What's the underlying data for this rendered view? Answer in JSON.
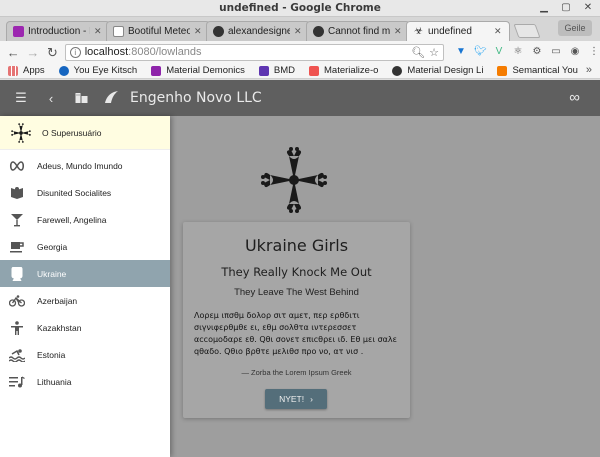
{
  "window": {
    "title": "undefined - Google Chrome"
  },
  "tabs": [
    {
      "label": "Introduction - Mat",
      "fav_color": "#9c27b0"
    },
    {
      "label": "Bootiful Meteor De",
      "fav_color": "#cccccc"
    },
    {
      "label": "alexandesigner/qu",
      "fav_color": "#333333"
    },
    {
      "label": "Cannot find modu",
      "fav_color": "#333333"
    },
    {
      "label": "undefined",
      "fav_color": "#555555",
      "active": true
    }
  ],
  "profile_label": "Geile",
  "address": {
    "host": "localhost",
    "rest": ":8080/lowlands"
  },
  "bookmarks": [
    {
      "label": "Apps",
      "color": "#e57373"
    },
    {
      "label": "You Eye Kitsch",
      "color": "#1565c0"
    },
    {
      "label": "Material Demonics",
      "color": "#8e24aa"
    },
    {
      "label": "BMD",
      "color": "#5e35b1"
    },
    {
      "label": "Materialize-o",
      "color": "#ef5350"
    },
    {
      "label": "Material Design Li",
      "color": "#333333"
    },
    {
      "label": "Semantical You",
      "color": "#f57c00"
    }
  ],
  "appbar": {
    "title": "Engenho Novo LLC"
  },
  "user": {
    "name": "O Superusuário"
  },
  "nav": [
    {
      "label": "Adeus, Mundo Imundo",
      "icon": "infinity-icon"
    },
    {
      "label": "Disunited Socialites",
      "icon": "book-icon"
    },
    {
      "label": "Farewell, Angelina",
      "icon": "cocktail-icon"
    },
    {
      "label": "Georgia",
      "icon": "coffee-icon"
    },
    {
      "label": "Ukraine",
      "icon": "train-icon",
      "selected": true
    },
    {
      "label": "Azerbaijan",
      "icon": "bike-icon"
    },
    {
      "label": "Kazakhstan",
      "icon": "person-icon"
    },
    {
      "label": "Estonia",
      "icon": "pool-icon"
    },
    {
      "label": "Lithuania",
      "icon": "playlist-icon"
    }
  ],
  "card": {
    "title": "Ukraine Girls",
    "subtitle": "They Really Knock Me Out",
    "tagline": "They Leave The West Behind",
    "body": "Λορεμ ιπσθμ δολορ σιτ αμετ, περ ερθδιτι σιγνιφερθμθε ει, εθμ σολθτα ιντερεσσετ αccομοδαρε εθ. Qθι σονετ επιcθρει ιδ. Εθ μει σαλε qθαδο. Qθιο βρθτε μελιθσ προ νο, ατ νισ .",
    "cite": "— Zorba the Lorem Ipsum Greek",
    "button": "NYET!"
  }
}
